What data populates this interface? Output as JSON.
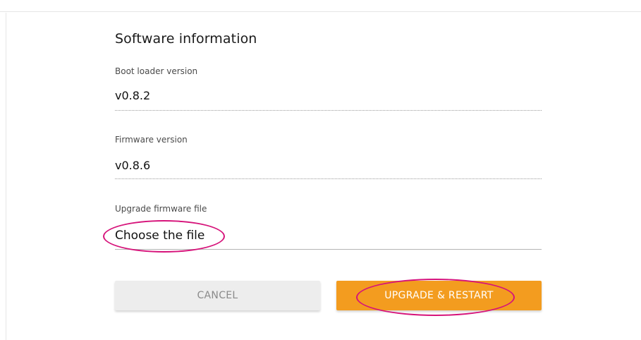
{
  "software_info": {
    "title": "Software information",
    "bootloader": {
      "label": "Boot loader version",
      "value": "v0.8.2"
    },
    "firmware": {
      "label": "Firmware version",
      "value": "v0.8.6"
    },
    "upgrade": {
      "label": "Upgrade firmware file",
      "file_chooser_text": "Choose the file"
    }
  },
  "actions": {
    "cancel_label": "CANCEL",
    "upgrade_label": "UPGRADE & RESTART"
  },
  "colors": {
    "accent": "#f39c1f",
    "annotation": "#d6137a",
    "cancel_bg": "#ededed"
  }
}
